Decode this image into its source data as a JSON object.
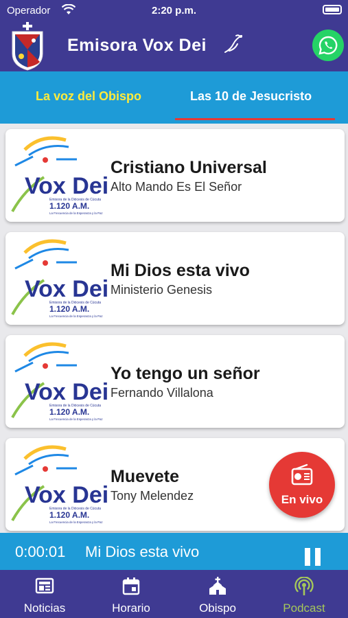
{
  "status_bar": {
    "carrier": "Operador",
    "time": "2:20 p.m."
  },
  "header": {
    "title": "Emisora Vox Dei",
    "icons": [
      "crest-logo",
      "dove-icon",
      "whatsapp-icon"
    ]
  },
  "tabs": [
    {
      "label": "La voz del Obispo",
      "selected": false
    },
    {
      "label": "Las 10 de Jesucristo",
      "selected": true
    }
  ],
  "logo_text": {
    "brand": "Vox Dei",
    "line1": "Emisora de la Diócesis de Cúcuta",
    "freq": "1.120 A.M.",
    "line2": "La Frecuencia de la Esperanza y la Paz"
  },
  "songs": [
    {
      "title": "Cristiano Universal",
      "artist": "Alto Mando Es El Señor"
    },
    {
      "title": "Mi Dios esta vivo",
      "artist": "Ministerio Genesis"
    },
    {
      "title": "Yo tengo un señor",
      "artist": "Fernando Villalona"
    },
    {
      "title": "Muevete",
      "artist": "Tony Melendez"
    }
  ],
  "live_button": {
    "label": "En vivo",
    "icon": "radio-icon"
  },
  "player": {
    "elapsed": "0:00:01",
    "track": "Mi Dios esta vivo",
    "icon": "pause-icon"
  },
  "bottom_nav": [
    {
      "label": "Noticias",
      "icon": "newspaper-icon",
      "active": false
    },
    {
      "label": "Horario",
      "icon": "calendar-icon",
      "active": false
    },
    {
      "label": "Obispo",
      "icon": "church-icon",
      "active": false
    },
    {
      "label": "Podcast",
      "icon": "podcast-icon",
      "active": true
    }
  ],
  "colors": {
    "header": "#3f3a92",
    "tabs": "#1e9bd7",
    "tab_selected_text": "#ffeb3b",
    "indicator": "#e53935",
    "live": "#e53935",
    "nav_active": "#a5c85a"
  }
}
